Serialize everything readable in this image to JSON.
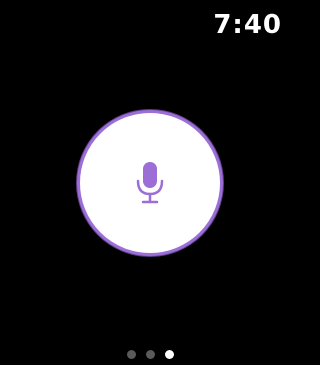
{
  "status_bar": {
    "time": "7:40"
  },
  "voice_input": {
    "icon": "microphone-icon",
    "accent_color": "#9b6fd6"
  },
  "pager": {
    "page_count": 3,
    "active_index": 2
  }
}
